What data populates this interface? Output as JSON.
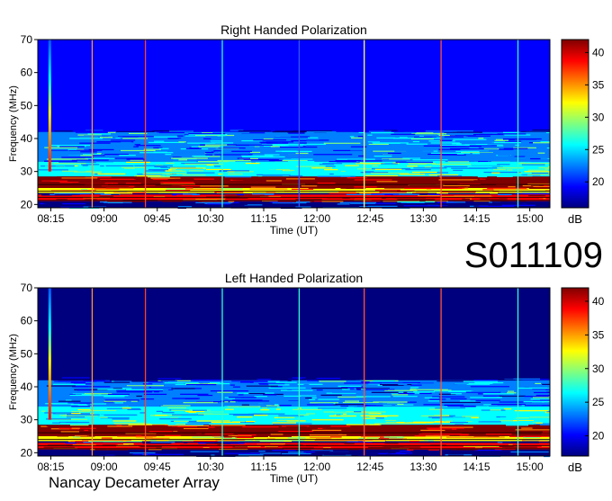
{
  "station_code": "S011109",
  "footer_label": "Nancay Decameter Array",
  "chart_data": [
    {
      "type": "heatmap",
      "title": "Right Handed Polarization",
      "xlabel": "Time (UT)",
      "ylabel": "Frequency (MHz)",
      "x_ticks": [
        "08:15",
        "09:00",
        "09:45",
        "10:30",
        "11:15",
        "12:00",
        "12:45",
        "13:30",
        "14:15",
        "15:00"
      ],
      "y_ticks": [
        20,
        30,
        40,
        50,
        60,
        70
      ],
      "ylim": [
        19,
        70
      ],
      "colorbar": {
        "label": "dB",
        "ticks": [
          20,
          25,
          30,
          35,
          40
        ],
        "range": [
          16,
          42
        ]
      },
      "colormap": [
        "#00007f",
        "#0000ff",
        "#007fff",
        "#00ffff",
        "#7fff7f",
        "#ffff00",
        "#ff7f00",
        "#ff0000",
        "#7f0000"
      ],
      "vertical_markers": [
        {
          "time": "08:50",
          "color": "#ff9933"
        },
        {
          "time": "09:35",
          "color": "#ff4422"
        },
        {
          "time": "10:40",
          "color": "#33ffcc"
        },
        {
          "time": "11:45",
          "color": "#3355ff"
        },
        {
          "time": "12:40",
          "color": "#ffff66"
        },
        {
          "time": "13:45",
          "color": "#ff5533"
        },
        {
          "time": "14:50",
          "color": "#33ffcc"
        }
      ],
      "bands": [
        {
          "from": 25,
          "to": 28.5,
          "level": 40
        },
        {
          "from": 23.5,
          "to": 25,
          "level": 33
        },
        {
          "from": 21,
          "to": 23,
          "level": 38
        },
        {
          "from": 28.5,
          "to": 33,
          "level": 27
        },
        {
          "from": 33,
          "to": 42,
          "level": 24
        },
        {
          "from": 42,
          "to": 70,
          "level": 19
        }
      ]
    },
    {
      "type": "heatmap",
      "title": "Left Handed Polarization",
      "xlabel": "Time (UT)",
      "ylabel": "Frequency (MHz)",
      "x_ticks": [
        "08:15",
        "09:00",
        "09:45",
        "10:30",
        "11:15",
        "12:00",
        "12:45",
        "13:30",
        "14:15",
        "15:00"
      ],
      "y_ticks": [
        20,
        30,
        40,
        50,
        60,
        70
      ],
      "ylim": [
        19,
        70
      ],
      "colorbar": {
        "label": "dB",
        "ticks": [
          20,
          25,
          30,
          35,
          40
        ],
        "range": [
          17,
          42
        ]
      },
      "colormap": [
        "#00007f",
        "#0000ff",
        "#007fff",
        "#00ffff",
        "#7fff7f",
        "#ffff00",
        "#ff7f00",
        "#ff0000",
        "#7f0000"
      ],
      "vertical_markers": [
        {
          "time": "08:50",
          "color": "#ff9933"
        },
        {
          "time": "09:35",
          "color": "#ff4422"
        },
        {
          "time": "10:40",
          "color": "#33ffcc"
        },
        {
          "time": "11:45",
          "color": "#33ffcc"
        },
        {
          "time": "12:40",
          "color": "#ff5533"
        },
        {
          "time": "13:45",
          "color": "#ff5533"
        },
        {
          "time": "14:50",
          "color": "#33ffcc"
        }
      ],
      "bands": [
        {
          "from": 25,
          "to": 28.5,
          "level": 40
        },
        {
          "from": 23.5,
          "to": 25,
          "level": 33
        },
        {
          "from": 21,
          "to": 23,
          "level": 38
        },
        {
          "from": 28.5,
          "to": 34,
          "level": 28
        },
        {
          "from": 34,
          "to": 42,
          "level": 24
        },
        {
          "from": 42,
          "to": 70,
          "level": 19
        }
      ]
    }
  ]
}
